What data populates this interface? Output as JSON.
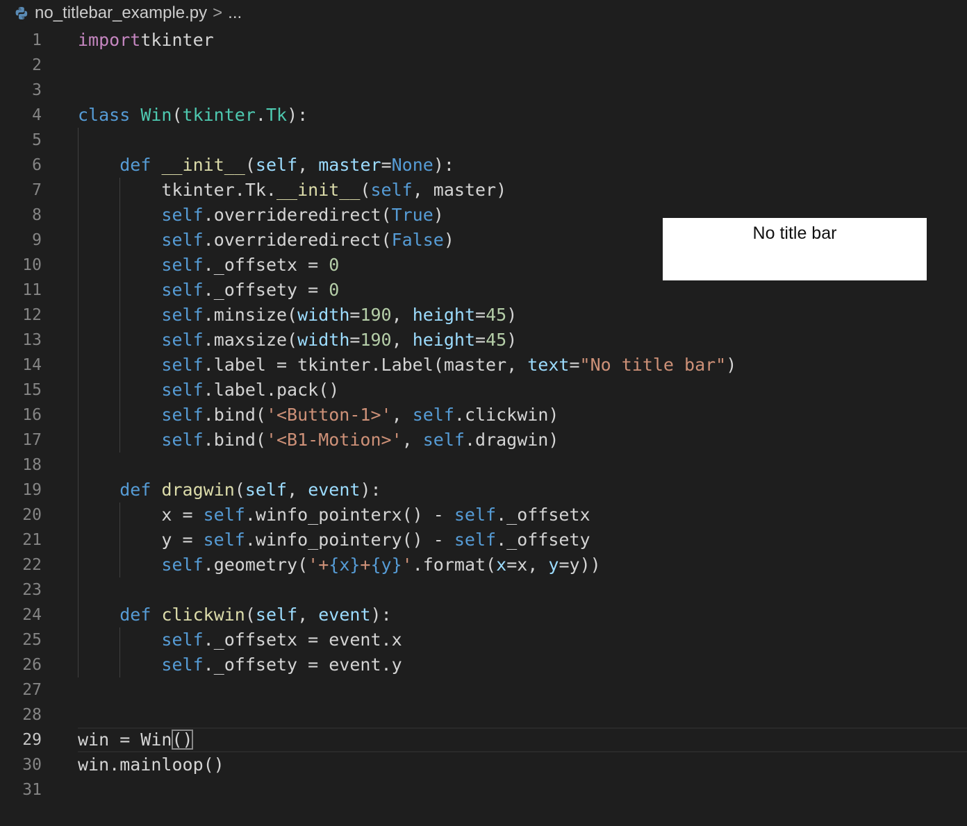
{
  "breadcrumb": {
    "filename": "no_titlebar_example.py",
    "separator": ">",
    "ellipsis": "..."
  },
  "tk_window": {
    "label": "No title bar"
  },
  "colors": {
    "background": "#1e1e1e",
    "keyword_control": "#c586c0",
    "keyword": "#569cd6",
    "class_name": "#4ec9b0",
    "function": "#dcdcaa",
    "parameter": "#9cdcfe",
    "number": "#b5cea8",
    "string": "#ce9178",
    "text": "#d4d4d4",
    "line_number": "#858585"
  },
  "current_line": 29,
  "code_lines": [
    [
      [
        "kw-imp",
        "import"
      ],
      [
        "",
        "tkinter"
      ]
    ],
    [],
    [],
    [
      [
        "kw",
        "class"
      ],
      [
        "cls",
        "Win"
      ],
      [
        "",
        "("
      ],
      [
        "cls",
        "tkinter"
      ],
      [
        "",
        ". "
      ],
      [
        "cls",
        "Tk"
      ],
      [
        "",
        "):"
      ]
    ],
    [],
    [
      [
        "",
        "    "
      ],
      [
        "kw",
        "def"
      ],
      [
        "",
        ""
      ],
      [
        "fn",
        "__init__"
      ],
      [
        "",
        "("
      ],
      [
        "param",
        "self"
      ],
      [
        "",
        ", "
      ],
      [
        "param",
        "master"
      ],
      [
        "",
        "="
      ],
      [
        "const",
        "None"
      ],
      [
        "",
        "):"
      ]
    ],
    [
      [
        "",
        "        tkinter.Tk."
      ],
      [
        "fn",
        "__init__"
      ],
      [
        "",
        "("
      ],
      [
        "self",
        "self"
      ],
      [
        "",
        ", master)"
      ]
    ],
    [
      [
        "",
        "        "
      ],
      [
        "self",
        "self"
      ],
      [
        "",
        ".overrideredirect("
      ],
      [
        "const",
        "True"
      ],
      [
        "",
        ")"
      ]
    ],
    [
      [
        "",
        "        "
      ],
      [
        "self",
        "self"
      ],
      [
        "",
        ".overrideredirect("
      ],
      [
        "const",
        "False"
      ],
      [
        "",
        ")"
      ]
    ],
    [
      [
        "",
        "        "
      ],
      [
        "self",
        "self"
      ],
      [
        "",
        "._offsetx = "
      ],
      [
        "num",
        "0"
      ]
    ],
    [
      [
        "",
        "        "
      ],
      [
        "self",
        "self"
      ],
      [
        "",
        "._offsety = "
      ],
      [
        "num",
        "0"
      ]
    ],
    [
      [
        "",
        "        "
      ],
      [
        "self",
        "self"
      ],
      [
        "",
        ".minsize("
      ],
      [
        "param",
        "width"
      ],
      [
        "",
        "="
      ],
      [
        "num",
        "190"
      ],
      [
        "",
        ", "
      ],
      [
        "param",
        "height"
      ],
      [
        "",
        "="
      ],
      [
        "num",
        "45"
      ],
      [
        "",
        ")"
      ]
    ],
    [
      [
        "",
        "        "
      ],
      [
        "self",
        "self"
      ],
      [
        "",
        ".maxsize("
      ],
      [
        "param",
        "width"
      ],
      [
        "",
        "="
      ],
      [
        "num",
        "190"
      ],
      [
        "",
        ", "
      ],
      [
        "param",
        "height"
      ],
      [
        "",
        "="
      ],
      [
        "num",
        "45"
      ],
      [
        "",
        ")"
      ]
    ],
    [
      [
        "",
        "        "
      ],
      [
        "self",
        "self"
      ],
      [
        "",
        ".label = tkinter.Label(master, "
      ],
      [
        "param",
        "text"
      ],
      [
        "",
        "="
      ],
      [
        "str",
        "\"No title bar\""
      ],
      [
        "",
        ")"
      ]
    ],
    [
      [
        "",
        "        "
      ],
      [
        "self",
        "self"
      ],
      [
        "",
        ".label.pack()"
      ]
    ],
    [
      [
        "",
        "        "
      ],
      [
        "self",
        "self"
      ],
      [
        "",
        ".bind("
      ],
      [
        "str",
        "'<Button-1>'"
      ],
      [
        "",
        ", "
      ],
      [
        "self",
        "self"
      ],
      [
        "",
        ".clickwin)"
      ]
    ],
    [
      [
        "",
        "        "
      ],
      [
        "self",
        "self"
      ],
      [
        "",
        ".bind("
      ],
      [
        "str",
        "'<B1-Motion>'"
      ],
      [
        "",
        ", "
      ],
      [
        "self",
        "self"
      ],
      [
        "",
        ".dragwin)"
      ]
    ],
    [],
    [
      [
        "",
        "    "
      ],
      [
        "kw",
        "def"
      ],
      [
        "",
        ""
      ],
      [
        "fn",
        "dragwin"
      ],
      [
        "",
        "("
      ],
      [
        "param",
        "self"
      ],
      [
        "",
        ", "
      ],
      [
        "param",
        "event"
      ],
      [
        "",
        "):"
      ]
    ],
    [
      [
        "",
        "        x = "
      ],
      [
        "self",
        "self"
      ],
      [
        "",
        ".winfo_pointerx() - "
      ],
      [
        "self",
        "self"
      ],
      [
        "",
        "._offsetx"
      ]
    ],
    [
      [
        "",
        "        y = "
      ],
      [
        "self",
        "self"
      ],
      [
        "",
        ".winfo_pointery() - "
      ],
      [
        "self",
        "self"
      ],
      [
        "",
        "._offsety"
      ]
    ],
    [
      [
        "",
        "        "
      ],
      [
        "self",
        "self"
      ],
      [
        "",
        ".geometry("
      ],
      [
        "str",
        "'+"
      ],
      [
        "kw",
        "{x}"
      ],
      [
        "str",
        "+"
      ],
      [
        "kw",
        "{y}"
      ],
      [
        "str",
        "'"
      ],
      [
        "",
        ".format("
      ],
      [
        "param",
        "x"
      ],
      [
        "",
        "=x, "
      ],
      [
        "param",
        "y"
      ],
      [
        "",
        "=y))"
      ]
    ],
    [],
    [
      [
        "",
        "    "
      ],
      [
        "kw",
        "def"
      ],
      [
        "",
        ""
      ],
      [
        "fn",
        "clickwin"
      ],
      [
        "",
        "("
      ],
      [
        "param",
        "self"
      ],
      [
        "",
        ", "
      ],
      [
        "param",
        "event"
      ],
      [
        "",
        "):"
      ]
    ],
    [
      [
        "",
        "        "
      ],
      [
        "self",
        "self"
      ],
      [
        "",
        "._offsetx = event.x"
      ]
    ],
    [
      [
        "",
        "        "
      ],
      [
        "self",
        "self"
      ],
      [
        "",
        "._offsety = event.y"
      ]
    ],
    [],
    [],
    [
      [
        "",
        "win = Win"
      ],
      [
        "match",
        "()"
      ]
    ],
    [
      [
        "",
        "win.mainloop()"
      ]
    ],
    []
  ]
}
